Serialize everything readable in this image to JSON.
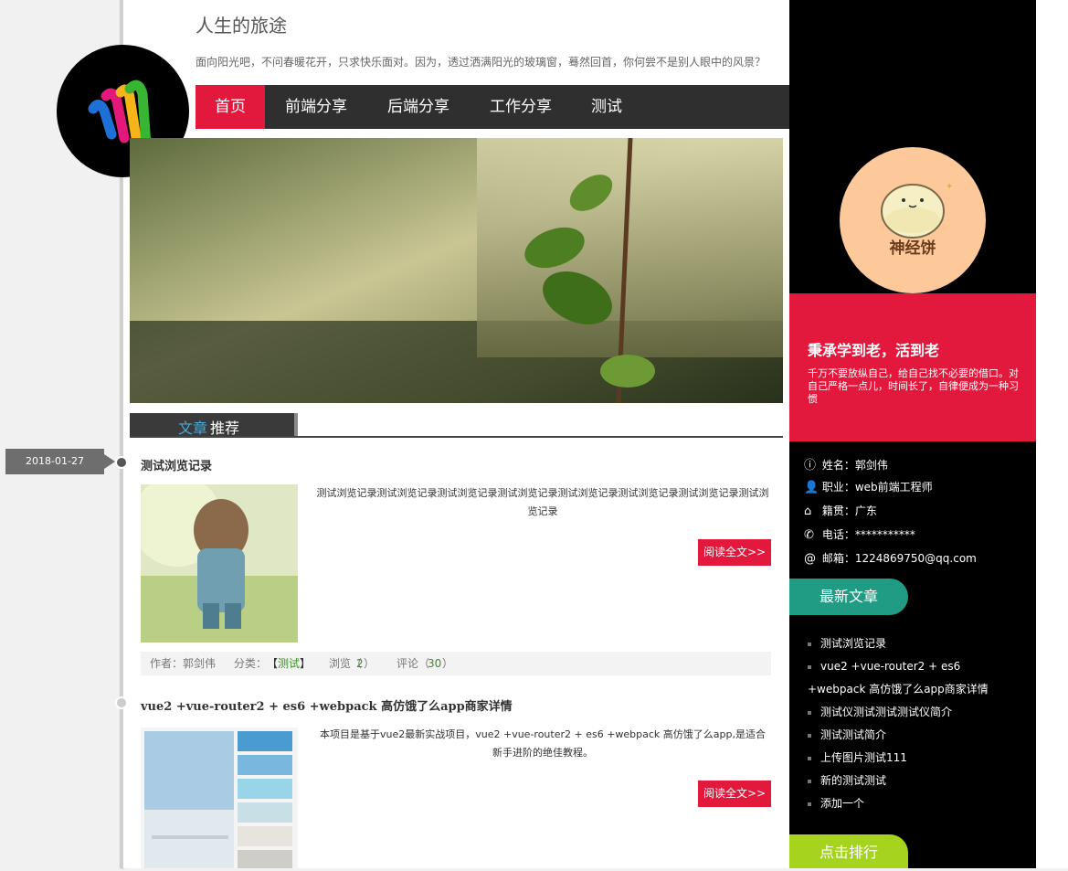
{
  "header": {
    "site_title": "人生的旅途",
    "motto": "面向阳光吧，不问春暖花开，只求快乐面对。因为，透过洒满阳光的玻璃窗，蓦然回首，你何尝不是别人眼中的风景？"
  },
  "nav": {
    "items": [
      {
        "label": "首页"
      },
      {
        "label": "前端分享"
      },
      {
        "label": "后端分享"
      },
      {
        "label": "工作分享"
      },
      {
        "label": "测试"
      }
    ],
    "active_color": "#e2183c"
  },
  "section": {
    "title_part1": "文章",
    "title_part2": "推荐"
  },
  "posts": [
    {
      "date": "2018-01-27",
      "title": "测试浏览记录",
      "summary": "测试浏览记录测试浏览记录测试浏览记录测试浏览记录测试浏览记录测试浏览记录测试浏览记录测试浏览记录",
      "read_more": "阅读全文>>",
      "author_label": "作者：郭剑伟",
      "category_label": "分类：",
      "category_open": "【",
      "category": "测试",
      "category_close": "】",
      "views_label": "浏览（",
      "views": "2",
      "views_close": "）",
      "comments_label": "评论（",
      "comments": "30",
      "comments_close": "）"
    },
    {
      "title": "vue2 +vue-router2 + es6 +webpack 高仿饿了么app商家详情",
      "summary": "本项目是基于vue2最新实战项目，vue2 +vue-router2 + es6 +webpack 高仿饿了么app,是适合新手进阶的绝佳教程。",
      "read_more": "阅读全文>>"
    }
  ],
  "sidebar": {
    "avatar_text": "神经饼",
    "quote_title": "秉承学到老，活到老",
    "quote_text": "千万不要放纵自己，给自己找不必要的借口。对自己严格一点儿，时间长了，自律便成为一种习惯",
    "info": [
      {
        "icon": "info-icon",
        "label": "姓名：郭剑伟"
      },
      {
        "icon": "user-plus-icon",
        "label": "职业：web前端工程师"
      },
      {
        "icon": "home-icon",
        "label": "籍贯：广东"
      },
      {
        "icon": "phone-icon",
        "label": "电话：***********"
      },
      {
        "icon": "at-icon",
        "label": "邮箱：1224869750@qq.com"
      }
    ],
    "latest_title": "最新文章",
    "latest": [
      "测试浏览记录",
      "vue2 +vue-router2 + es6 +webpack 高仿饿了么app商家详情",
      "测试仪测试测试测试仪简介",
      "测试测试简介",
      "上传图片测试111",
      "新的测试测试",
      "添加一个"
    ],
    "ranking_title": "点击排行",
    "colors": {
      "latest_pill": "#1f9c83",
      "ranking_pill": "#a6d41e",
      "quote_bg": "#e2183c"
    }
  }
}
